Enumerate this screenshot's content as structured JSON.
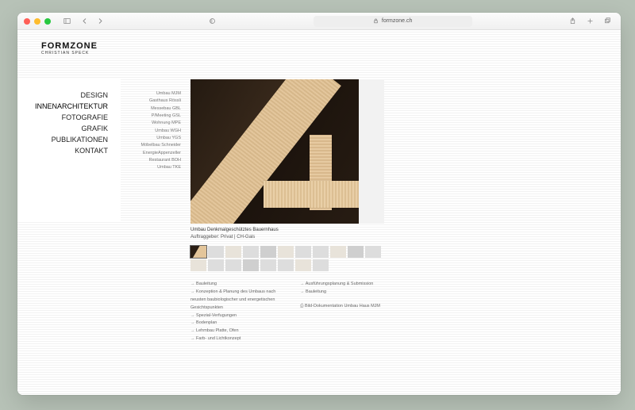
{
  "browser": {
    "url": "formzone.ch"
  },
  "header": {
    "logo": "FORMZONE",
    "subtitle": "CHRISTIAN SPECK"
  },
  "main_nav": [
    "DESIGN",
    "INNENARCHITEKTUR",
    "FOTOGRAFIE",
    "GRAFIK",
    "PUBLIKATIONEN",
    "KONTAKT"
  ],
  "main_nav_active_index": 1,
  "sub_nav": [
    "Umbau MJM",
    "Gasthaus Rössli",
    "Messebau GBL",
    "P/Meeting GSL",
    "Wohnung MPE",
    "Umbau WGH",
    "Umbau YGS",
    "Möbelbau Schneider",
    "EnergieAppenzeller",
    "Restaurant BOH",
    "Umbau TKE"
  ],
  "caption": {
    "line1": "Umbau Denkmalgeschütztes Bauernhaus",
    "line2": "Auftraggeber: Privat | CH-Gais"
  },
  "thumb_count": 19,
  "details_left": [
    "Bauleitung",
    "Konzeption & Planung des Umbaus nach neusten baubiologischer und energetischen Gesichtspunkten",
    "Spezial-Verfugungen",
    "Bodenplan",
    "Lehmbau Platte, Ofen",
    "Farb- und Lichtkonzept"
  ],
  "details_right_items": [
    "Ausführungsplanung & Submission",
    "Bauleitung"
  ],
  "details_right_pdf": "Bild-Dokumentation Umbau Haus MJM"
}
